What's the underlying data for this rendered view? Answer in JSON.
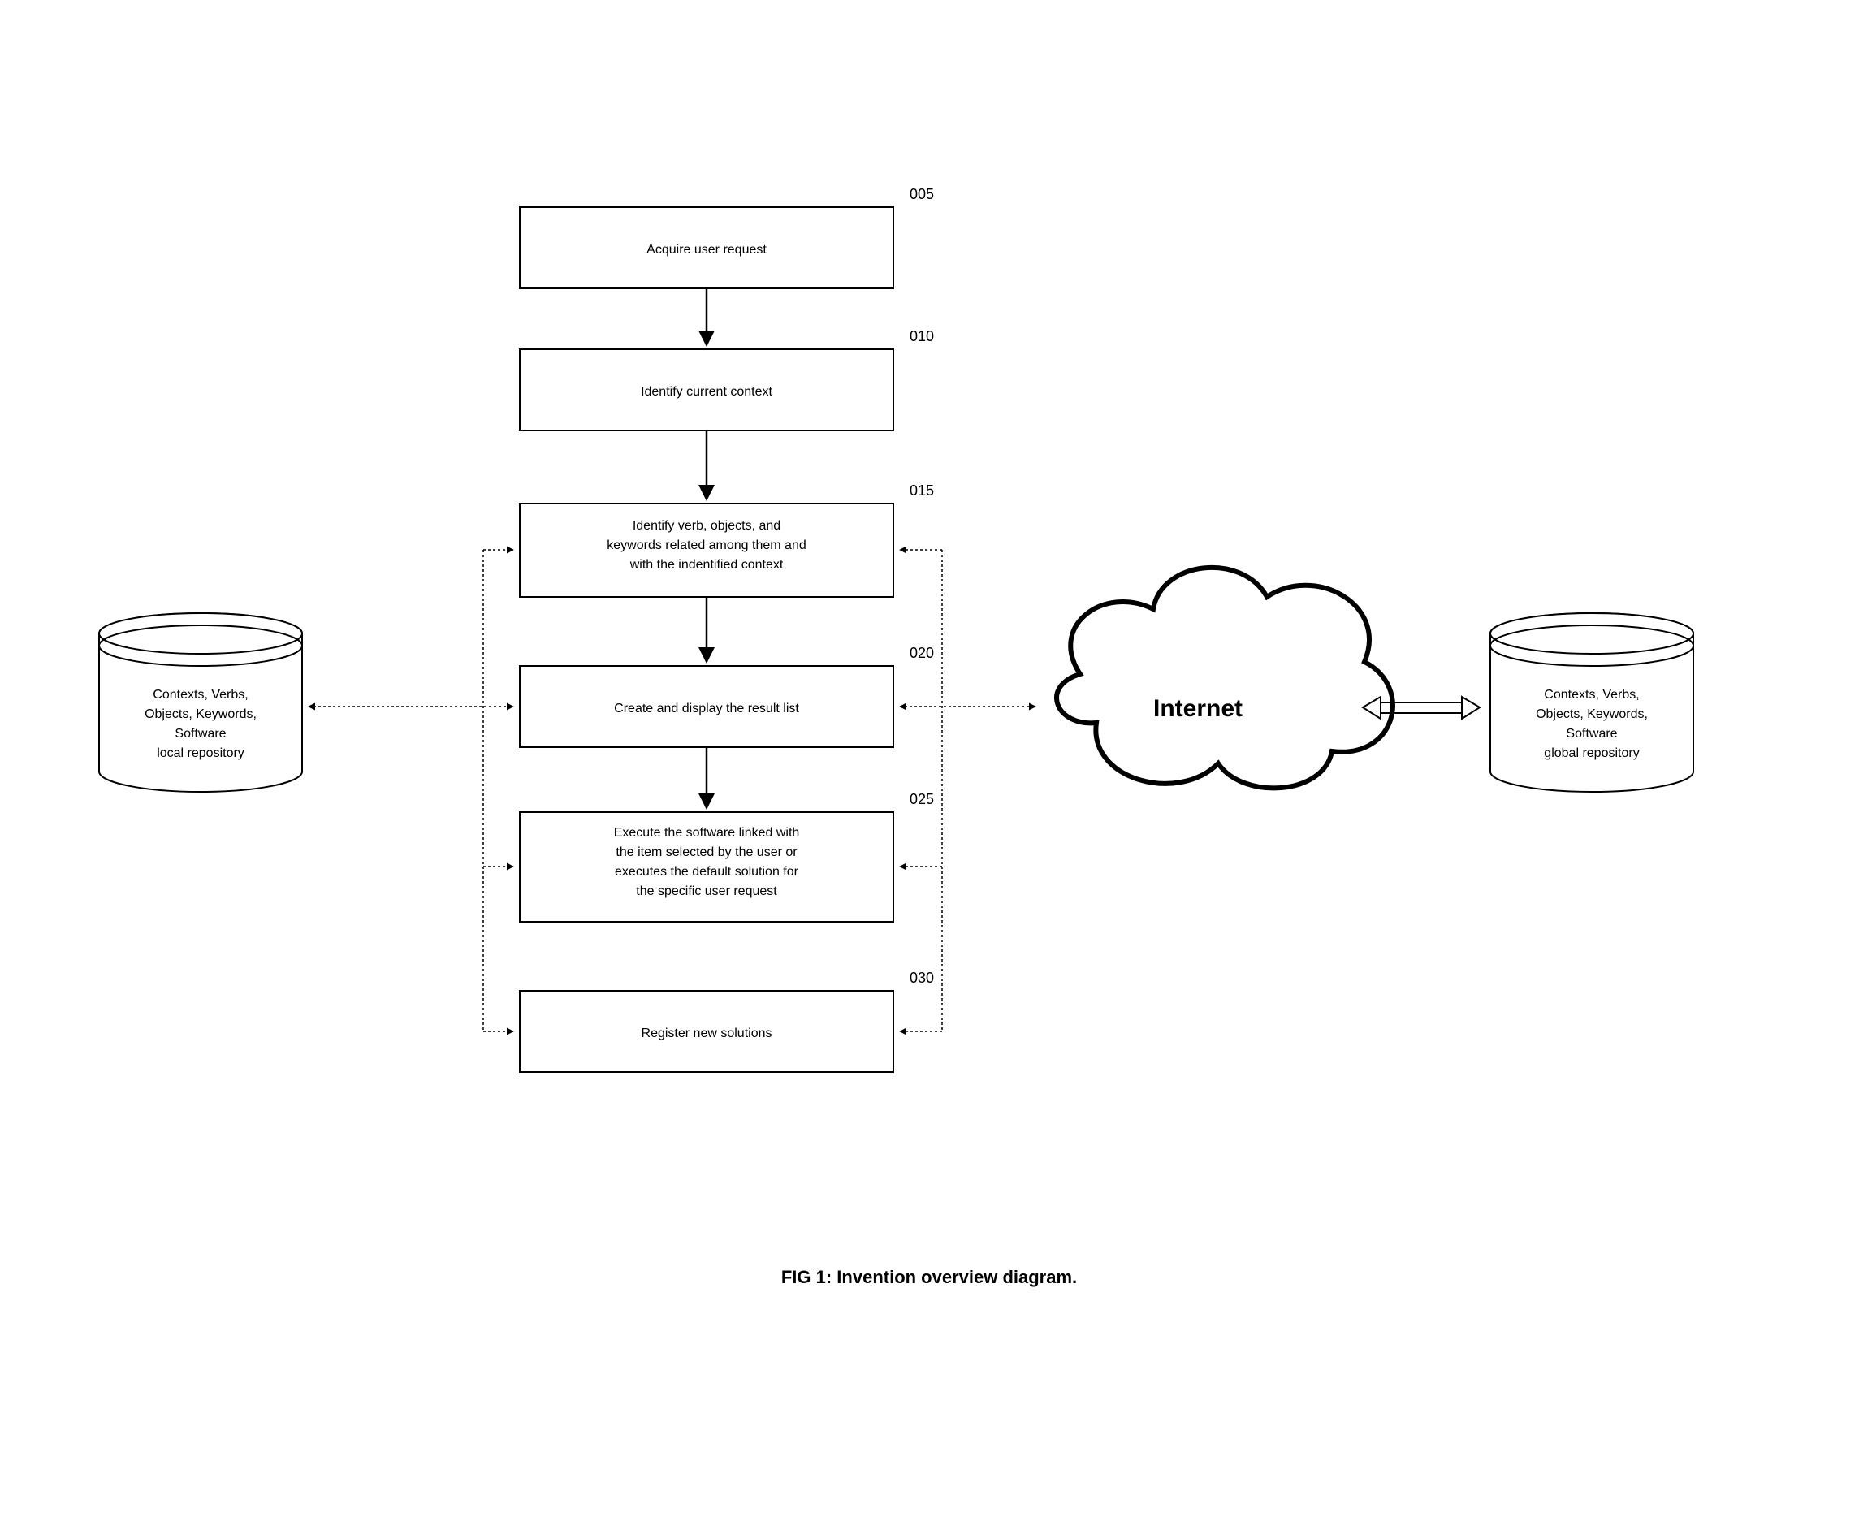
{
  "steps": [
    {
      "id": "005",
      "label": "Acquire user request"
    },
    {
      "id": "010",
      "label": "Identify current context"
    },
    {
      "id": "015",
      "label": "Identify verb, objects, and keywords related among them and with the indentified context"
    },
    {
      "id": "020",
      "label": "Create and display the result list"
    },
    {
      "id": "025",
      "label": "Execute the software linked with the item selected by the user or executes the default solution for the specific user request"
    },
    {
      "id": "030",
      "label": "Register new solutions"
    }
  ],
  "left_db": {
    "line1": "Contexts, Verbs,",
    "line2": "Objects, Keywords,",
    "line3": "Software",
    "line4": "local repository"
  },
  "right_db": {
    "line1": "Contexts, Verbs,",
    "line2": "Objects, Keywords,",
    "line3": "Software",
    "line4": "global repository"
  },
  "cloud": {
    "label": "Internet"
  },
  "caption": "FIG 1: Invention overview diagram."
}
